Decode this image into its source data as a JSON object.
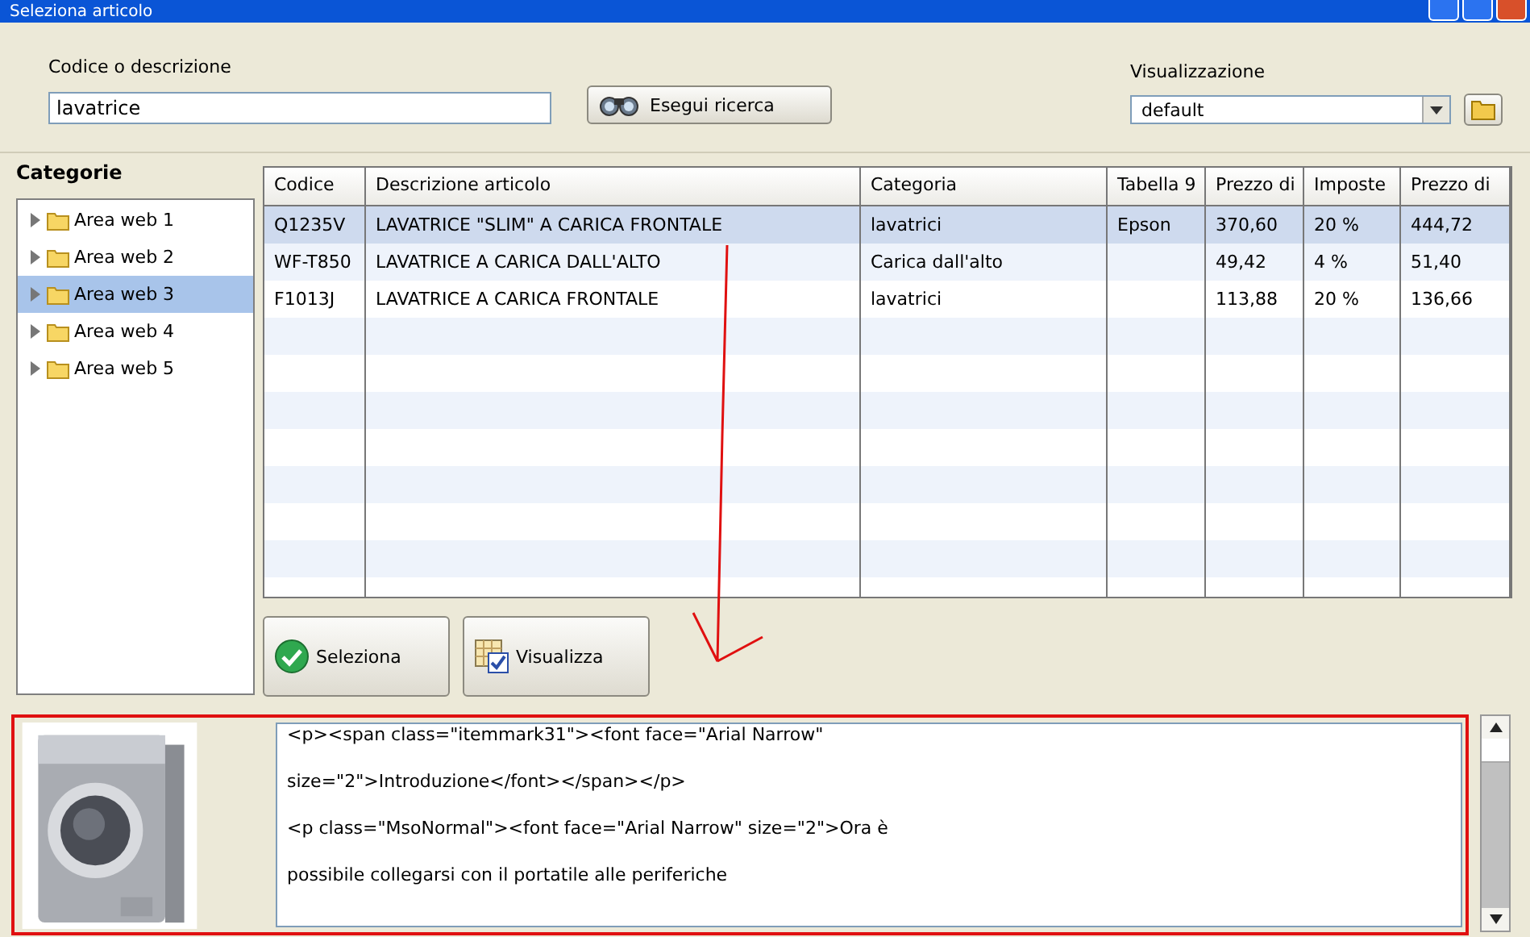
{
  "window": {
    "title": "Seleziona articolo"
  },
  "search": {
    "label": "Codice o descrizione",
    "value": "lavatrice",
    "button": "Esegui ricerca"
  },
  "view": {
    "label": "Visualizzazione",
    "value": "default"
  },
  "categories": {
    "title": "Categorie",
    "items": [
      {
        "label": "Area web 1",
        "selected": false
      },
      {
        "label": "Area web 2",
        "selected": false
      },
      {
        "label": "Area web 3",
        "selected": true
      },
      {
        "label": "Area web 4",
        "selected": false
      },
      {
        "label": "Area web 5",
        "selected": false
      }
    ]
  },
  "table": {
    "columns": [
      "Codice",
      "Descrizione articolo",
      "Categoria",
      "Tabella 9",
      "Prezzo di",
      "Imposte",
      "Prezzo di"
    ],
    "rows": [
      {
        "cells": [
          "Q1235V",
          "LAVATRICE \"SLIM\"  A CARICA FRONTALE",
          "lavatrici",
          "Epson",
          "370,60",
          "20 %",
          "444,72"
        ],
        "selected": true
      },
      {
        "cells": [
          "WF-T850",
          "LAVATRICE A CARICA DALL'ALTO",
          "Carica dall'alto",
          "",
          "49,42",
          "4 %",
          "51,40"
        ],
        "selected": false
      },
      {
        "cells": [
          "F1013J",
          "LAVATRICE A CARICA FRONTALE",
          "lavatrici",
          "",
          "113,88",
          "20 %",
          "136,66"
        ],
        "selected": false
      }
    ]
  },
  "actions": [
    "Seleziona",
    "Visualizza"
  ],
  "description": {
    "lines": [
      "<p><span class=\"itemmark31\"><font face=\"Arial Narrow\"",
      "size=\"2\">Introduzione</font></span></p>",
      "<p class=\"MsoNormal\"><font face=\"Arial Narrow\" size=\"2\">Ora è",
      "possibile collegarsi con il portatile alle periferiche"
    ]
  }
}
